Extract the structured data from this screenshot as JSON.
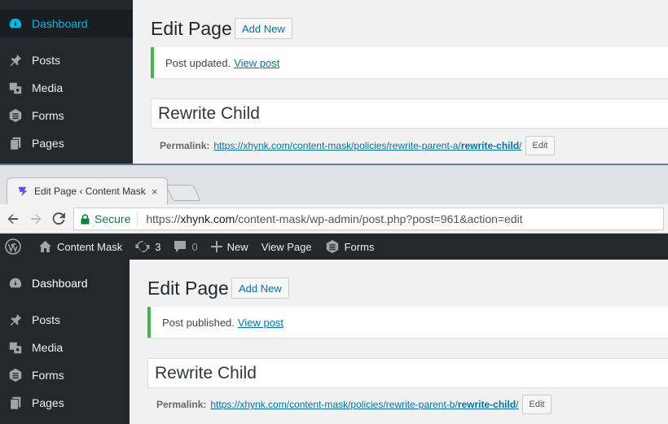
{
  "top_screen": {
    "sidebar": [
      {
        "label": "Dashboard",
        "icon": "dashboard-icon",
        "current": true
      },
      {
        "label": "Posts",
        "icon": "pin-icon"
      },
      {
        "label": "Media",
        "icon": "media-icon"
      },
      {
        "label": "Forms",
        "icon": "forms-icon"
      },
      {
        "label": "Pages",
        "icon": "pages-icon"
      }
    ],
    "page_title": "Edit Page",
    "add_new": "Add New",
    "notice_text": "Post updated.",
    "notice_link": "View post",
    "post_title": "Rewrite Child",
    "permalink_label": "Permalink:",
    "permalink_base": "https://xhynk.com/content-mask/policies/rewrite-parent-a/",
    "permalink_slug": "rewrite-child",
    "permalink_tail": "/",
    "edit_button": "Edit"
  },
  "browser": {
    "tab_title": "Edit Page ‹ Content Mask",
    "tab_close": "×",
    "secure_label": "Secure",
    "url_scheme": "https://",
    "url_host": "xhynk.com",
    "url_path": "/content-mask/wp-admin/post.php?post=961&action=edit"
  },
  "adminbar": {
    "site_name": "Content Mask",
    "updates_count": "3",
    "comments_count": "0",
    "new_label": "New",
    "view_page": "View Page",
    "forms_label": "Forms"
  },
  "bottom_screen": {
    "sidebar": [
      {
        "label": "Dashboard",
        "icon": "dashboard-icon"
      },
      {
        "label": "Posts",
        "icon": "pin-icon"
      },
      {
        "label": "Media",
        "icon": "media-icon"
      },
      {
        "label": "Forms",
        "icon": "forms-icon"
      },
      {
        "label": "Pages",
        "icon": "pages-icon"
      }
    ],
    "page_title": "Edit Page",
    "add_new": "Add New",
    "notice_text": "Post published.",
    "notice_link": "View post",
    "post_title": "Rewrite Child",
    "permalink_label": "Permalink:",
    "permalink_base": "https://xhynk.com/content-mask/policies/rewrite-parent-b/",
    "permalink_slug": "rewrite-child",
    "permalink_tail": "/",
    "edit_button": "Edit"
  },
  "colors": {
    "sidebar_bg": "#23282d",
    "accent_blue": "#0073aa",
    "current_menu": "#00b9eb",
    "notice_green": "#46b450"
  }
}
